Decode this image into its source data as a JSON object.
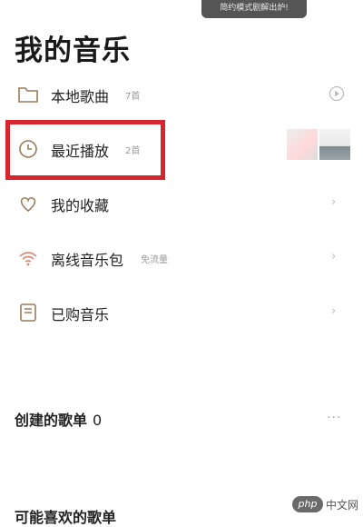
{
  "toast": {
    "text": "简约模式剧解出炉!"
  },
  "page": {
    "title": "我的音乐"
  },
  "rows": [
    {
      "label": "本地歌曲",
      "count": "7首",
      "icon": "folder-icon",
      "trailing": "play-circle-icon"
    },
    {
      "label": "最近播放",
      "count": "2首",
      "icon": "clock-icon",
      "trailing": "thumbnails"
    },
    {
      "label": "我的收藏",
      "count": "",
      "icon": "heart-icon",
      "trailing": "chevron-right-icon"
    },
    {
      "label": "离线音乐包",
      "count": "免流量",
      "icon": "wifi-icon",
      "trailing": "chevron-right-icon"
    },
    {
      "label": "已购音乐",
      "count": "",
      "icon": "purchase-icon",
      "trailing": "chevron-right-icon"
    }
  ],
  "sections": {
    "created": {
      "title": "创建的歌单",
      "count": "0"
    },
    "liked": {
      "title": "可能喜欢的歌单"
    }
  },
  "chevron": "›",
  "more": "···",
  "watermark": {
    "logo": "php",
    "text": "中文网"
  },
  "colors": {
    "highlight": "#d7252d",
    "icon": "#9b7b5a"
  }
}
